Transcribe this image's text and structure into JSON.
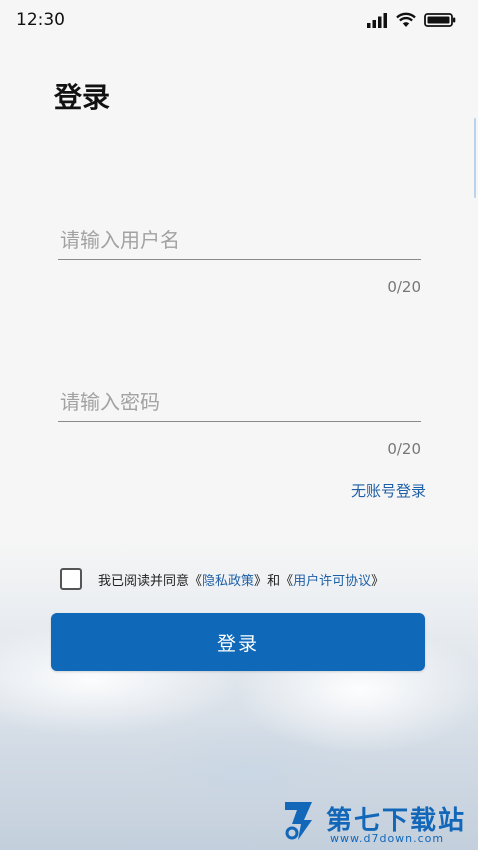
{
  "status_bar": {
    "time": "12:30"
  },
  "page": {
    "title": "登录"
  },
  "username": {
    "placeholder": "请输入用户名",
    "value": "",
    "counter": "0/20"
  },
  "password": {
    "placeholder": "请输入密码",
    "value": "",
    "counter": "0/20"
  },
  "no_account_label": "无账号登录",
  "agreement": {
    "prefix": "我已阅读并同意",
    "privacy_open": "《",
    "privacy_link": "隐私政策",
    "privacy_close": "》",
    "connector": "和",
    "license_open": "《",
    "license_link": "用户许可协议",
    "license_close": "》",
    "checked": false
  },
  "login_button": {
    "label": "登录"
  },
  "watermark": {
    "brand": "第七下载站",
    "url": "www.d7down.com"
  },
  "colors": {
    "accent": "#0f68b8",
    "link": "#1f5fa6"
  }
}
